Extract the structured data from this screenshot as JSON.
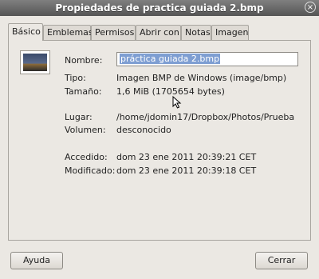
{
  "window": {
    "title": "Propiedades de practica guiada 2.bmp",
    "close_glyph": "×"
  },
  "tabs": [
    {
      "label": "Básico",
      "active": true
    },
    {
      "label": "Emblemas"
    },
    {
      "label": "Permisos"
    },
    {
      "label": "Abrir con"
    },
    {
      "label": "Notas"
    },
    {
      "label": "Imagen"
    }
  ],
  "basic": {
    "nombre_label": "Nombre:",
    "nombre_value": "práctica guiada 2.bmp",
    "tipo_label": "Tipo:",
    "tipo_value": "Imagen BMP de Windows (image/bmp)",
    "tamano_label": "Tamaño:",
    "tamano_value": "1,6 MiB (1705654 bytes)",
    "lugar_label": "Lugar:",
    "lugar_value": "/home/jdomin17/Dropbox/Photos/Prueba",
    "volumen_label": "Volumen:",
    "volumen_value": "desconocido",
    "accedido_label": "Accedido:",
    "accedido_value": "dom 23 ene 2011 20:39:21 CET",
    "modificado_label": "Modificado:",
    "modificado_value": "dom 23 ene 2011 20:39:18 CET"
  },
  "buttons": {
    "help": "Ayuda",
    "close": "Cerrar"
  }
}
